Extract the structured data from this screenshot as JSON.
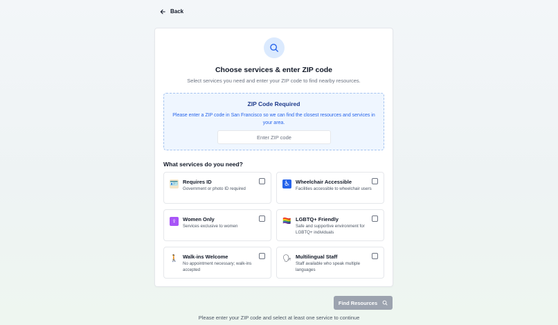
{
  "nav": {
    "back_label": "Back"
  },
  "header": {
    "icon": "search-icon",
    "title": "Choose services & enter ZIP code",
    "subtitle": "Select services you need and enter your ZIP code to find nearby resources."
  },
  "zip": {
    "title": "ZIP Code Required",
    "message": "Please enter a ZIP code in San Francisco so we can find the closest resources and services in your area.",
    "placeholder": "Enter ZIP code",
    "value": ""
  },
  "services": {
    "heading": "What services do you need?",
    "items": [
      {
        "icon": "id-card-icon",
        "glyph": "🪪",
        "title": "Requires ID",
        "description": "Government or photo ID required",
        "checked": false
      },
      {
        "icon": "wheelchair-icon",
        "glyph": "♿",
        "title": "Wheelchair Accessible",
        "description": "Facilities accessible to wheelchair users",
        "checked": false
      },
      {
        "icon": "female-sign-icon",
        "glyph": "♀",
        "title": "Women Only",
        "description": "Services exclusive to women",
        "checked": false
      },
      {
        "icon": "rainbow-flag-icon",
        "glyph": "🏳️‍🌈",
        "title": "LGBTQ+ Friendly",
        "description": "Safe and supportive environment for LGBTQ+ individuals",
        "checked": false
      },
      {
        "icon": "walking-person-icon",
        "glyph": "🚶",
        "title": "Walk-ins Welcome",
        "description": "No appointment necessary; walk-ins accepted",
        "checked": false
      },
      {
        "icon": "speaking-head-icon",
        "glyph": "🗣",
        "title": "Multilingual Staff",
        "description": "Staff available who speak multiple languages",
        "checked": false
      }
    ]
  },
  "actions": {
    "find_label": "Find Resources",
    "find_icon": "search-icon",
    "helper_text": "Please enter your ZIP code and select at least one service to continue"
  },
  "colors": {
    "accent": "#2563eb",
    "accent_light": "#dbeafe",
    "notice_bg": "#eff6ff",
    "button_disabled": "#9ca3af"
  }
}
